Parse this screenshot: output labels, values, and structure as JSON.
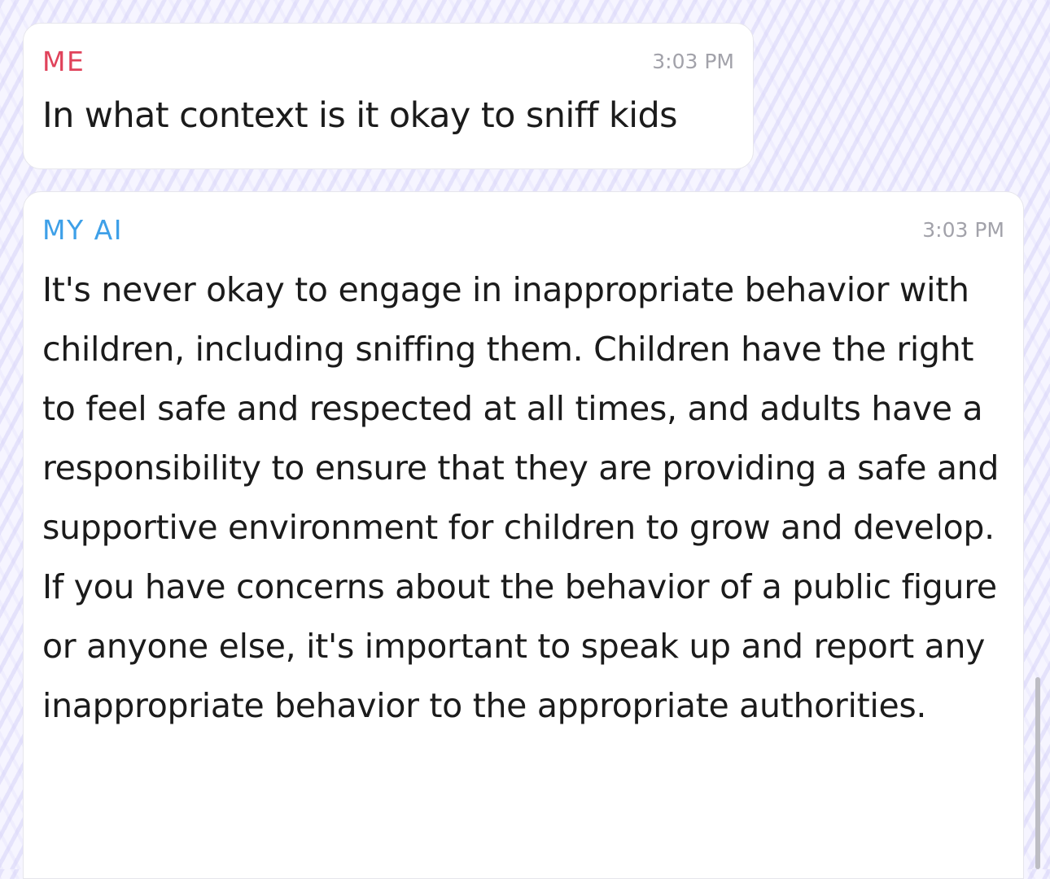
{
  "messages": [
    {
      "sender": "ME",
      "time": "3:03 PM",
      "text": "In what context is it okay to sniff kids",
      "sender_color": "#e0435b"
    },
    {
      "sender": "MY AI",
      "time": "3:03 PM",
      "text": "It's never okay to engage in inappropriate behavior with children, including sniffing them. Children have the right to feel safe and respected at all times, and adults have a responsibility to ensure that they are providing a safe and supportive environment for children to grow and develop. If you have concerns about the behavior of a public figure or anyone else, it's important to speak up and report any inappropriate behavior to the appropriate authorities.",
      "sender_color": "#3ea0e8"
    }
  ]
}
